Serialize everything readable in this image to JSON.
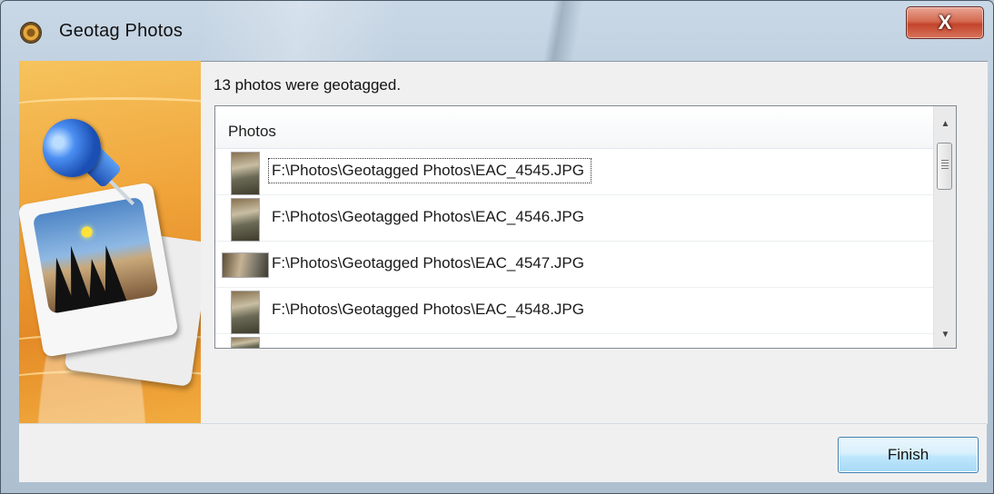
{
  "window": {
    "title": "Geotag Photos",
    "close_label": "X"
  },
  "status": {
    "message": "13 photos were geotagged."
  },
  "list": {
    "column_header": "Photos",
    "rows": [
      {
        "path": "F:\\Photos\\Geotagged Photos\\EAC_4545.JPG"
      },
      {
        "path": "F:\\Photos\\Geotagged Photos\\EAC_4546.JPG"
      },
      {
        "path": "F:\\Photos\\Geotagged Photos\\EAC_4547.JPG"
      },
      {
        "path": "F:\\Photos\\Geotagged Photos\\EAC_4548.JPG"
      }
    ]
  },
  "footer": {
    "finish_label": "Finish"
  },
  "icons": {
    "app": "geotag-app-icon",
    "banner": "pushpin-photo-illustration",
    "scroll_up": "scroll-up-arrow-icon",
    "scroll_down": "scroll-down-arrow-icon"
  }
}
